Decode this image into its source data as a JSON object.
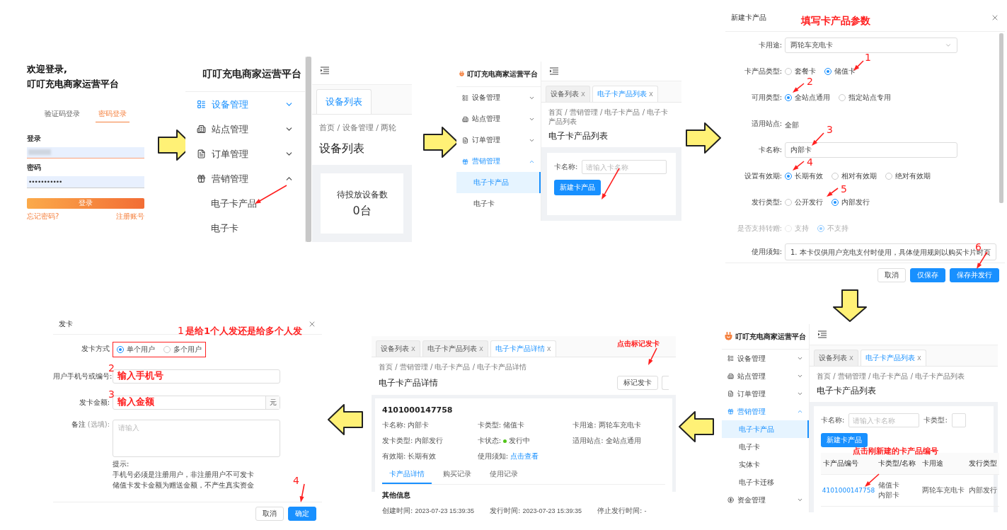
{
  "flow_arrows": [
    {
      "kind": "right"
    },
    {
      "kind": "right"
    },
    {
      "kind": "right"
    },
    {
      "kind": "down"
    },
    {
      "kind": "left"
    },
    {
      "kind": "left"
    }
  ],
  "login": {
    "heading": "欢迎登录,",
    "platform": "叮叮充电商家运营平台",
    "tabs": [
      {
        "label": "验证码登录",
        "selected": false
      },
      {
        "label": "密码登录",
        "selected": true
      }
    ],
    "account_label": "登录",
    "password_label": "密码",
    "password_value": "•••••••••••",
    "submit": "登录",
    "forgot_link": "忘记密码?",
    "register_link": "注册账号"
  },
  "device_screen": {
    "sidebar": {
      "logo_text": "叮叮充电商家运营平台",
      "items": [
        {
          "label": "设备管理",
          "selected": true,
          "expanded": false
        },
        {
          "label": "站点管理",
          "selected": false,
          "expanded": false
        },
        {
          "label": "订单管理",
          "selected": false,
          "expanded": false
        },
        {
          "label": "营销管理",
          "selected": false,
          "expanded": true,
          "children": [
            {
              "label": "电子卡产品",
              "selected": false
            },
            {
              "label": "电子卡",
              "selected": false
            }
          ]
        }
      ]
    },
    "tabs": [
      {
        "label": "设备列表",
        "selected": true
      }
    ],
    "breadcrumb": "首页 / 设备管理 / 两轮",
    "title": "设备列表",
    "stat": {
      "label": "待投放设备数",
      "value": "0台"
    }
  },
  "product_list_screen": {
    "sidebar": {
      "logo_text": "叮叮充电商家运营平台",
      "items": [
        {
          "label": "设备管理",
          "selected": false,
          "expanded": false
        },
        {
          "label": "站点管理",
          "selected": false,
          "expanded": false
        },
        {
          "label": "订单管理",
          "selected": false,
          "expanded": false
        },
        {
          "label": "营销管理",
          "selected": true,
          "expanded": true,
          "children": [
            {
              "label": "电子卡产品",
              "selected": true
            },
            {
              "label": "电子卡",
              "selected": false
            }
          ]
        }
      ]
    },
    "tabs": [
      {
        "label": "设备列表",
        "close": "x",
        "selected": false
      },
      {
        "label": "电子卡产品列表",
        "close": "x",
        "selected": true
      }
    ],
    "breadcrumb": "首页 / 营销管理 / 电子卡产品 / 电子卡产品列表",
    "title": "电子卡产品列表",
    "filters": [
      {
        "label": "卡名称:",
        "placeholder": "请输入卡名称"
      }
    ],
    "create_button": "新建卡产品"
  },
  "new_product_dialog": {
    "title": "新建卡产品",
    "note": "填写卡产品参数",
    "steps": [
      "1",
      "2",
      "3",
      "4",
      "5",
      "6"
    ],
    "form": [
      {
        "label": "卡用途:",
        "kind": "select",
        "value": "两轮车充电卡",
        "disabled": false
      },
      {
        "label": "卡产品类型:",
        "kind": "radio",
        "disabled": false,
        "options": [
          {
            "label": "套餐卡",
            "selected": false
          },
          {
            "label": "储值卡",
            "selected": true
          }
        ]
      },
      {
        "label": "可用类型:",
        "kind": "radio",
        "disabled": false,
        "options": [
          {
            "label": "全站点通用",
            "selected": true
          },
          {
            "label": "指定站点专用",
            "selected": false
          }
        ]
      },
      {
        "label": "适用站点:",
        "kind": "text",
        "value": "全部",
        "disabled": false
      },
      {
        "label": "卡名称:",
        "kind": "input",
        "value": "内部卡",
        "disabled": false
      },
      {
        "label": "设置有效期:",
        "kind": "radio",
        "disabled": false,
        "options": [
          {
            "label": "长期有效",
            "selected": true
          },
          {
            "label": "相对有效期",
            "selected": false
          },
          {
            "label": "绝对有效期",
            "selected": false
          }
        ]
      },
      {
        "label": "发行类型:",
        "kind": "radio",
        "disabled": false,
        "options": [
          {
            "label": "公开发行",
            "selected": false
          },
          {
            "label": "内部发行",
            "selected": true
          }
        ]
      },
      {
        "label": "是否支持转赠:",
        "kind": "radio",
        "disabled": true,
        "options": [
          {
            "label": "支持",
            "selected": false
          },
          {
            "label": "不支持",
            "selected": true
          }
        ]
      },
      {
        "label": "使用须知:",
        "kind": "textarea",
        "value": "1. 本卡仅供用户充电支付时使用，具体使用规则以购买卡片时页",
        "disabled": false
      }
    ],
    "buttons": [
      {
        "label": "取消",
        "kind": "default"
      },
      {
        "label": "仅保存",
        "kind": "primary"
      },
      {
        "label": "保存并发行",
        "kind": "primary"
      }
    ]
  },
  "product_table_screen": {
    "sidebar": {
      "logo_text": "叮叮充电商家运营平台",
      "items": [
        {
          "label": "设备管理",
          "selected": false,
          "expanded": false
        },
        {
          "label": "站点管理",
          "selected": false,
          "expanded": false
        },
        {
          "label": "订单管理",
          "selected": false,
          "expanded": false
        },
        {
          "label": "营销管理",
          "selected": true,
          "expanded": true,
          "children": [
            {
              "label": "电子卡产品",
              "selected": true
            },
            {
              "label": "电子卡",
              "selected": false
            },
            {
              "label": "实体卡",
              "selected": false
            },
            {
              "label": "电子卡迁移",
              "selected": false
            }
          ]
        },
        {
          "label": "资金管理",
          "selected": false,
          "expanded": false
        }
      ]
    },
    "tabs": [
      {
        "label": "设备列表",
        "close": "x",
        "selected": false
      },
      {
        "label": "电子卡产品列表",
        "close": "x",
        "selected": true
      }
    ],
    "breadcrumb": "首页 / 营销管理 / 电子卡产品 / 电子卡产品列表",
    "title": "电子卡产品列表",
    "filters": [
      {
        "label": "卡名称:",
        "placeholder": "请输入卡名称"
      },
      {
        "label": "卡类型:"
      }
    ],
    "create_button": "新建卡产品",
    "note": "点击刚新建的卡产品编号",
    "table": {
      "columns": [
        "卡产品编号",
        "卡类型/名称",
        "卡用途",
        "发行类型"
      ],
      "rows": [
        {
          "number": "4101000147758",
          "type": "储值卡",
          "name": "内部卡",
          "usage": "两轮车充电卡",
          "issue_type": "内部发行"
        }
      ]
    }
  },
  "product_detail_screen": {
    "tabs": [
      {
        "label": "设备列表",
        "close": "x",
        "selected": false
      },
      {
        "label": "电子卡产品列表",
        "close": "x",
        "selected": false
      },
      {
        "label": "电子卡产品详情",
        "close": "x",
        "selected": true
      }
    ],
    "breadcrumb": "首页 / 营销管理 / 电子卡产品 / 电子卡产品详情",
    "title": "电子卡产品详情",
    "action": "标记发卡",
    "note": "点击标记发卡",
    "card_number": "4101000147758",
    "fields": [
      {
        "label": "卡名称:",
        "value": "内部卡",
        "kind": "text"
      },
      {
        "label": "卡类型:",
        "value": "储值卡",
        "kind": "text"
      },
      {
        "label": "卡用途:",
        "value": "两轮车充电卡",
        "kind": "text"
      },
      {
        "label": "发卡类型:",
        "value": "内部发行",
        "kind": "text"
      },
      {
        "label": "卡状态:",
        "value": "发行中",
        "kind": "status"
      },
      {
        "label": "适用站点:",
        "value": "全站点通用",
        "kind": "text"
      },
      {
        "label": "有效期:",
        "value": "长期有效",
        "kind": "text"
      },
      {
        "label": "使用须知:",
        "value": "点击查看",
        "kind": "link"
      }
    ],
    "detail_tabs": [
      {
        "label": "卡产品详情",
        "selected": true
      },
      {
        "label": "购买记录",
        "selected": false
      },
      {
        "label": "使用记录",
        "selected": false
      }
    ],
    "section_title": "其他信息",
    "times": [
      {
        "label": "创建时间:",
        "value": "2023-07-23 15:39:35"
      },
      {
        "label": "发行时间:",
        "value": "2023-07-23 15:39:35"
      },
      {
        "label": "停止发行时间:",
        "value": "-"
      }
    ]
  },
  "issue_card_dialog": {
    "title": "发卡",
    "note": "是给1个人发还是给多个人发",
    "steps": [
      "1",
      "2",
      "3",
      "4"
    ],
    "method": {
      "label": "发卡方式",
      "options": [
        {
          "label": "单个用户",
          "selected": true
        },
        {
          "label": "多个用户",
          "selected": false
        }
      ]
    },
    "phone": {
      "label": "用户手机号或编号:",
      "note": "输入手机号"
    },
    "amount": {
      "label": "发卡金额:",
      "note": "输入金额",
      "suffix": "元"
    },
    "remark": {
      "label": "备注",
      "hint": "(选填):",
      "placeholder": "请输入"
    },
    "tips": [
      "提示:",
      "手机号必须是注册用户，非注册用户不可发卡",
      "储值卡发卡金额为赠送金额，不产生真实资金"
    ],
    "cancel": "取消",
    "confirm": "确定"
  }
}
